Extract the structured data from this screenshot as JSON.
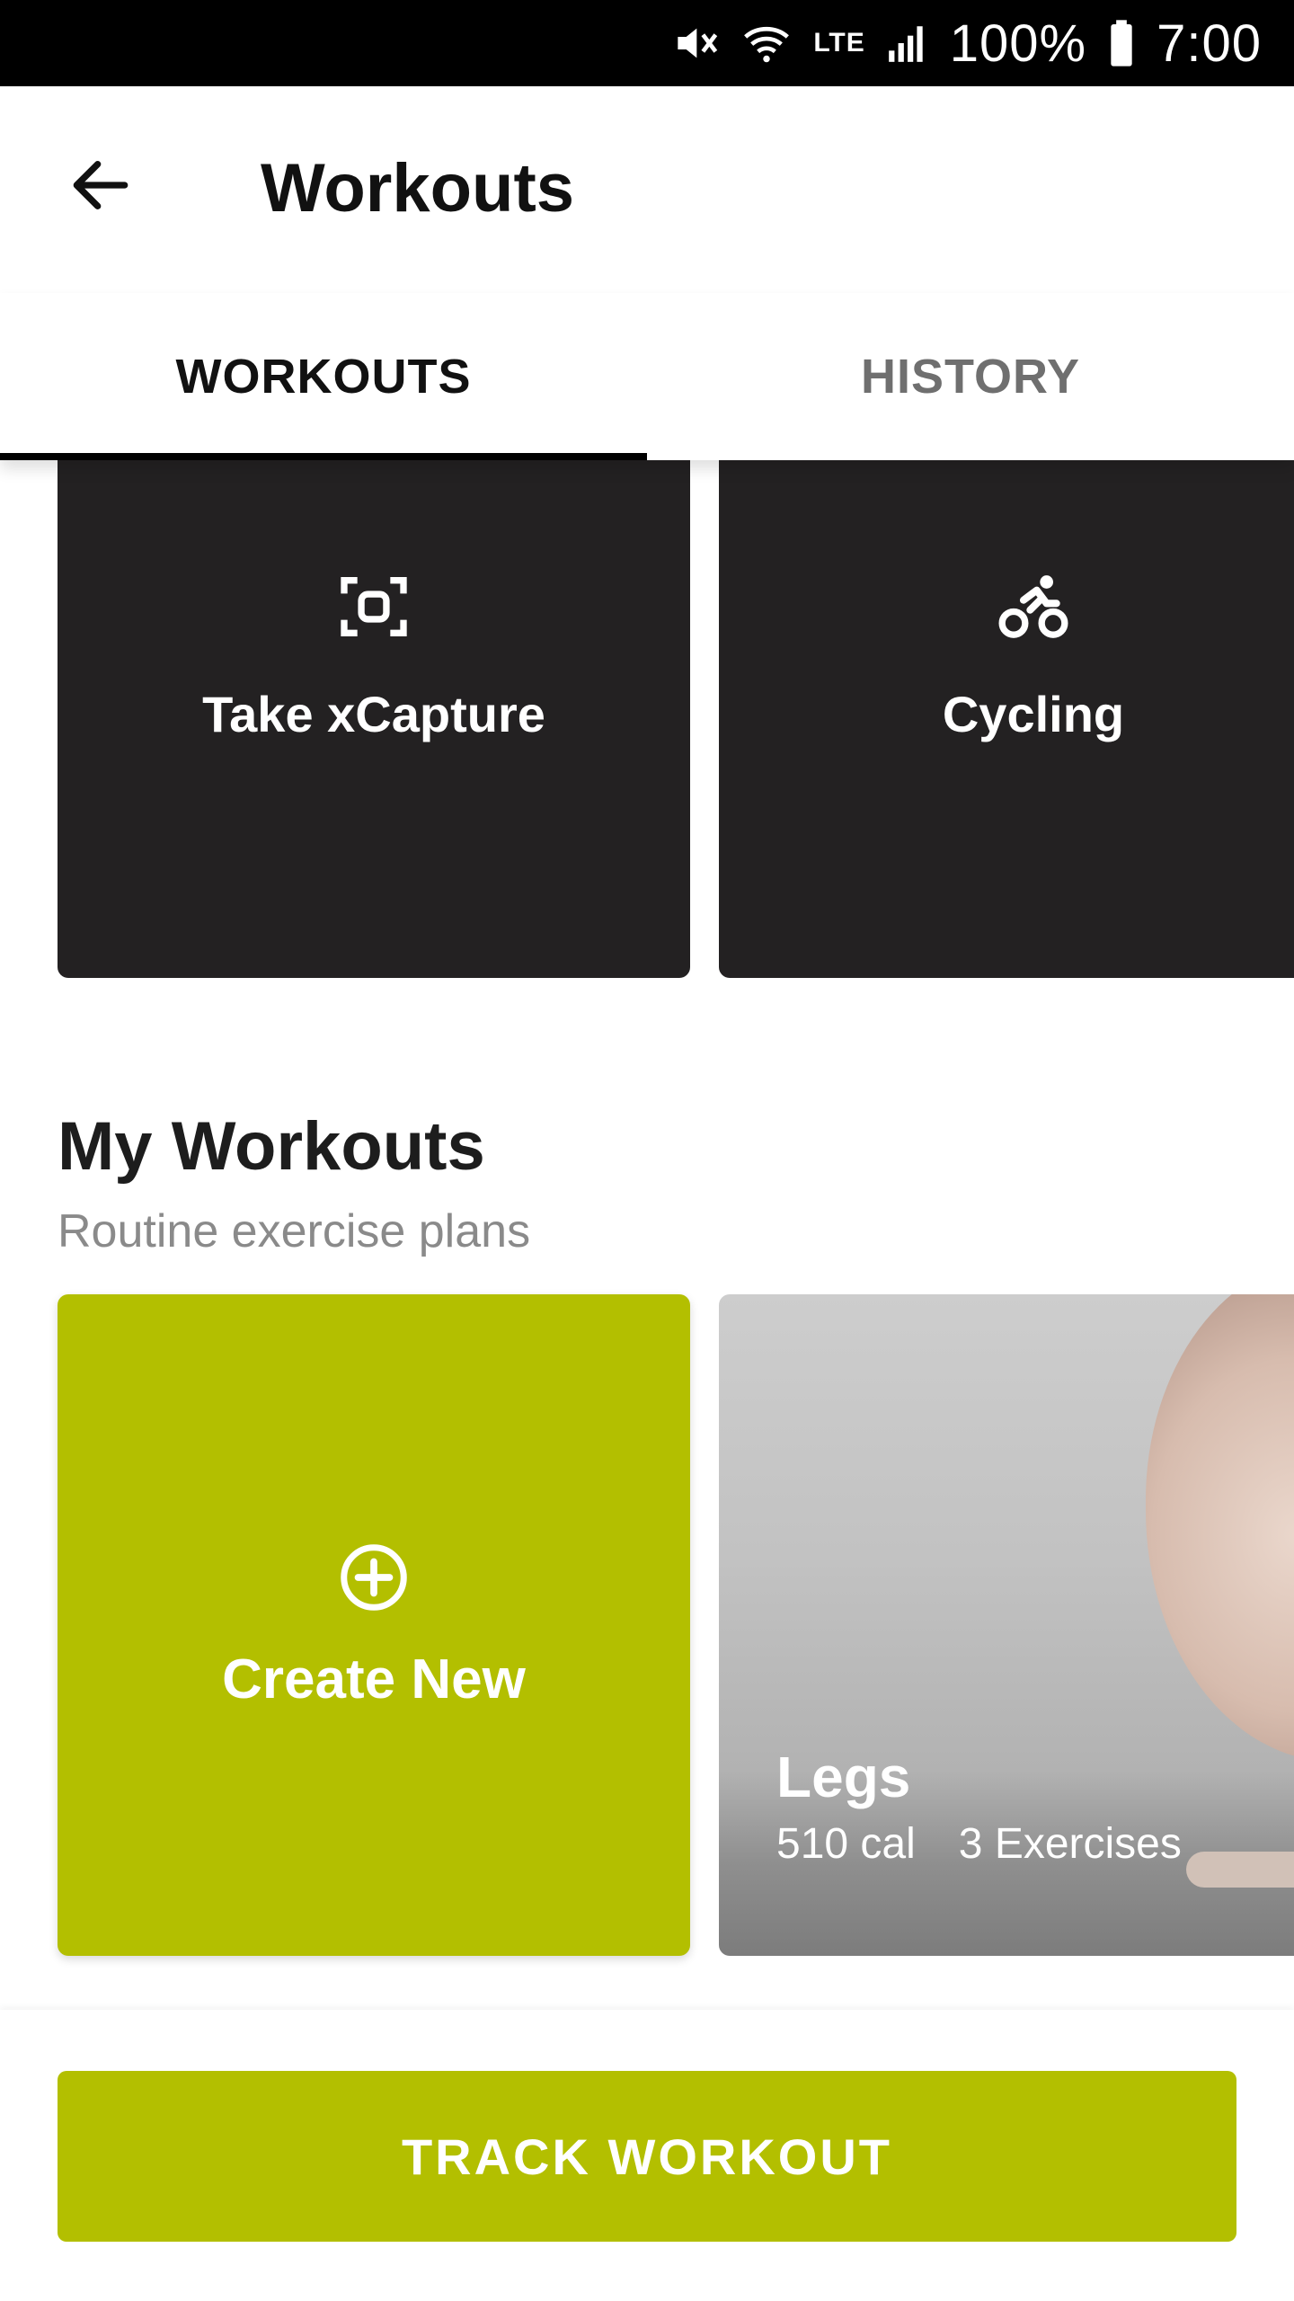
{
  "status_bar": {
    "battery_percent": "100%",
    "time": "7:00",
    "network_label": "LTE",
    "icons": [
      "mute-vibrate-icon",
      "wifi-icon",
      "lte-icon",
      "signal-icon",
      "battery-icon"
    ]
  },
  "header": {
    "title": "Workouts",
    "back_icon": "arrow-left-icon"
  },
  "tabs": [
    {
      "label": "WORKOUTS",
      "active": true
    },
    {
      "label": "HISTORY",
      "active": false
    }
  ],
  "quick_cards": [
    {
      "label": "Take xCapture",
      "icon": "capture-icon"
    },
    {
      "label": "Cycling",
      "icon": "cycling-icon"
    }
  ],
  "my_workouts": {
    "title": "My Workouts",
    "subtitle": "Routine exercise plans",
    "create_card": {
      "label": "Create New",
      "icon": "plus-circle-icon"
    },
    "workouts": [
      {
        "name": "Legs",
        "calories": "510 cal",
        "exercises": "3 Exercises"
      }
    ]
  },
  "bottom": {
    "track_label": "TRACK WORKOUT"
  },
  "colors": {
    "accent": "#b3bf00",
    "dark_card": "#232122",
    "status_bar": "#000000"
  }
}
